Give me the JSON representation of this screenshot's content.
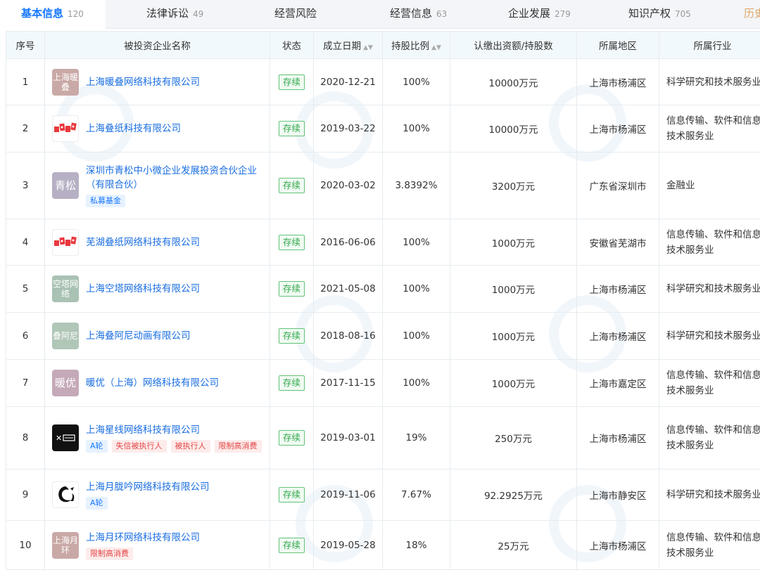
{
  "tabs": [
    {
      "label": "基本信息",
      "count": "120",
      "active": true
    },
    {
      "label": "法律诉讼",
      "count": "49"
    },
    {
      "label": "经营风险",
      "count": ""
    },
    {
      "label": "经营信息",
      "count": "63"
    },
    {
      "label": "企业发展",
      "count": "279"
    },
    {
      "label": "知识产权",
      "count": "705"
    },
    {
      "label": "历史",
      "count": ""
    }
  ],
  "columns": [
    "序号",
    "被投资企业名称",
    "状态",
    "成立日期",
    "持股比例",
    "认缴出资额/持股数",
    "所属地区",
    "所属行业"
  ],
  "rows": [
    {
      "no": "1",
      "logo_text": "上海暖叠",
      "logo_color": "#c9a9a6",
      "name": "上海暖叠网络科技有限公司",
      "tags": [],
      "status": "存续",
      "date": "2020-12-21",
      "ratio": "100%",
      "capital": "10000万元",
      "region": "上海市杨浦区",
      "industry": "科学研究和技术服务业"
    },
    {
      "no": "2",
      "logo_text": "",
      "logo_color": "#ffffff",
      "logo_icon": "diezhi-red-logo",
      "name": "上海叠纸科技有限公司",
      "tags": [],
      "status": "存续",
      "date": "2019-03-22",
      "ratio": "100%",
      "capital": "10000万元",
      "region": "上海市杨浦区",
      "industry": "信息传输、软件和信息技术服务业"
    },
    {
      "no": "3",
      "logo_text": "青松",
      "logo_color": "#b7b0c4",
      "name": "深圳市青松中小微企业发展投资合伙企业（有限合伙）",
      "tags": [
        {
          "text": "私募基金",
          "kind": "blue"
        }
      ],
      "status": "存续",
      "date": "2020-03-02",
      "ratio": "3.8392%",
      "capital": "3200万元",
      "region": "广东省深圳市",
      "industry": "金融业"
    },
    {
      "no": "4",
      "logo_text": "",
      "logo_color": "#ffffff",
      "logo_icon": "diezhi-red-logo",
      "name": "芜湖叠纸网络科技有限公司",
      "tags": [],
      "status": "存续",
      "date": "2016-06-06",
      "ratio": "100%",
      "capital": "1000万元",
      "region": "安徽省芜湖市",
      "industry": "信息传输、软件和信息技术服务业"
    },
    {
      "no": "5",
      "logo_text": "空塔网络",
      "logo_color": "#a9c2b3",
      "name": "上海空塔网络科技有限公司",
      "tags": [],
      "status": "存续",
      "date": "2021-05-08",
      "ratio": "100%",
      "capital": "1000万元",
      "region": "上海市杨浦区",
      "industry": "科学研究和技术服务业"
    },
    {
      "no": "6",
      "logo_text": "叠阿尼",
      "logo_color": "#b0c6b7",
      "name": "上海叠阿尼动画有限公司",
      "tags": [],
      "status": "存续",
      "date": "2018-08-16",
      "ratio": "100%",
      "capital": "1000万元",
      "region": "上海市杨浦区",
      "industry": "科学研究和技术服务业"
    },
    {
      "no": "7",
      "logo_text": "暖优",
      "logo_color": "#c5a9b9",
      "name": "暖优（上海）网络科技有限公司",
      "tags": [],
      "status": "存续",
      "date": "2017-11-15",
      "ratio": "100%",
      "capital": "1000万元",
      "region": "上海市嘉定区",
      "industry": "信息传输、软件和信息技术服务业"
    },
    {
      "no": "8",
      "logo_text": "",
      "logo_color": "#111111",
      "logo_icon": "xingxian-logo",
      "name": "上海星线网络科技有限公司",
      "tags": [
        {
          "text": "A轮",
          "kind": "blue"
        },
        {
          "text": "失信被执行人",
          "kind": "red"
        },
        {
          "text": "被执行人",
          "kind": "red"
        },
        {
          "text": "限制高消费",
          "kind": "red"
        }
      ],
      "status": "存续",
      "date": "2019-03-01",
      "ratio": "19%",
      "capital": "250万元",
      "region": "上海市杨浦区",
      "industry": "信息传输、软件和信息技术服务业"
    },
    {
      "no": "9",
      "logo_text": "",
      "logo_color": "#ffffff",
      "logo_icon": "dragon-logo",
      "name": "上海月胧吟网络科技有限公司",
      "tags": [
        {
          "text": "A轮",
          "kind": "blue"
        }
      ],
      "status": "存续",
      "date": "2019-11-06",
      "ratio": "7.67%",
      "capital": "92.2925万元",
      "region": "上海市静安区",
      "industry": "科学研究和技术服务业"
    },
    {
      "no": "10",
      "logo_text": "上海月环",
      "logo_color": "#c9a9a6",
      "name": "上海月环网络科技有限公司",
      "tags": [
        {
          "text": "限制高消费",
          "kind": "red"
        }
      ],
      "status": "存续",
      "date": "2019-05-28",
      "ratio": "18%",
      "capital": "25万元",
      "region": "上海市杨浦区",
      "industry": "信息传输、软件和信息技术服务业"
    }
  ],
  "colors": {
    "accent": "#1677ff",
    "link": "#1a6ee0",
    "status_green": "#2fa64a"
  }
}
